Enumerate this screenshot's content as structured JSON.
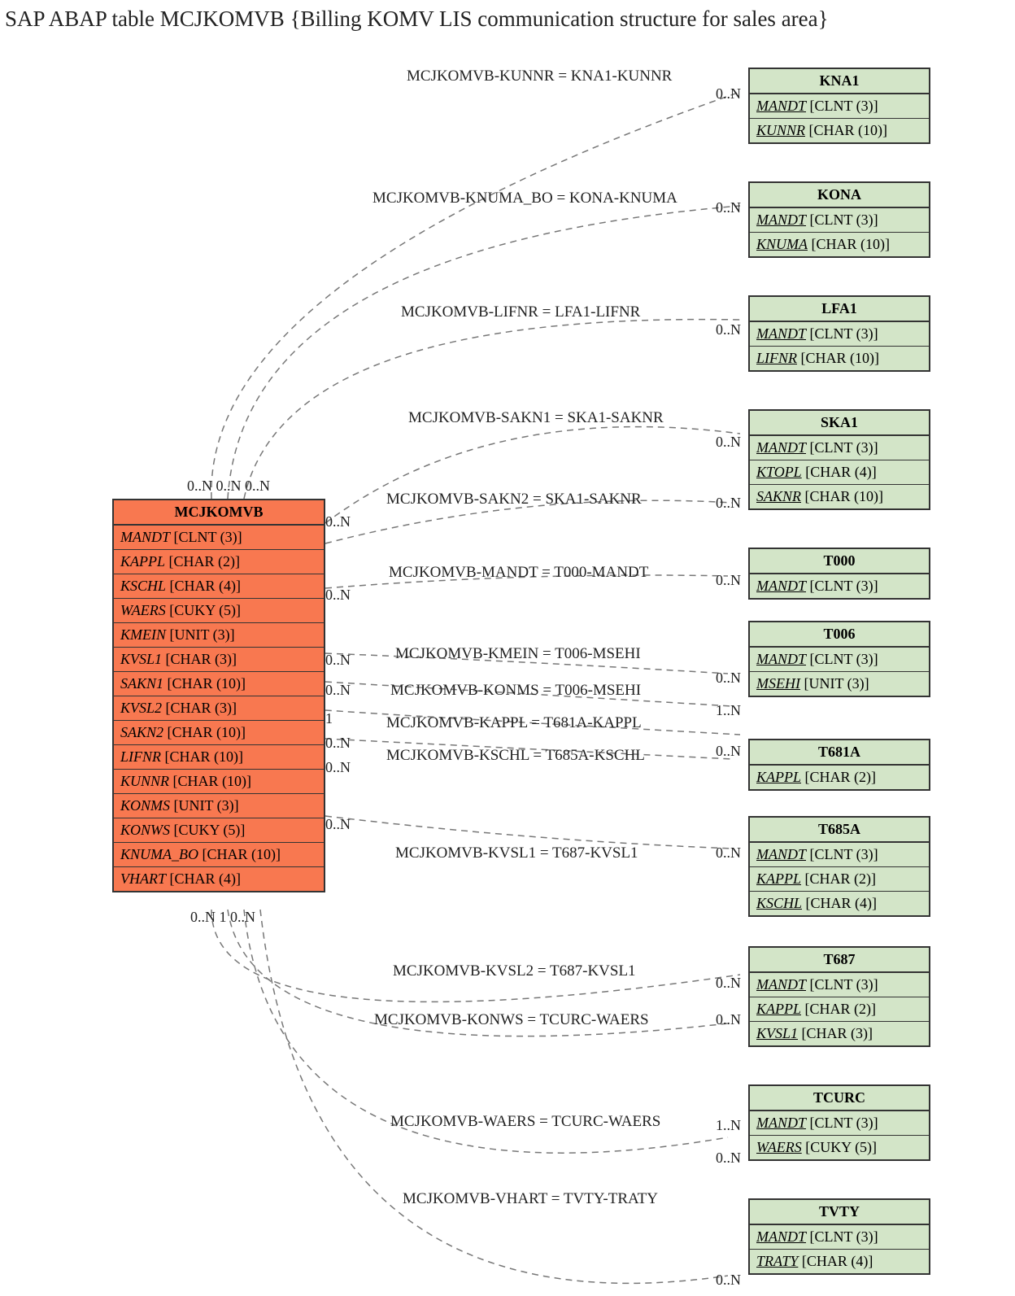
{
  "title": "SAP ABAP table MCJKOMVB {Billing KOMV LIS communication structure for sales area}",
  "main_table": {
    "name": "MCJKOMVB",
    "fields": [
      {
        "name": "MANDT",
        "type": "CLNT (3)"
      },
      {
        "name": "KAPPL",
        "type": "CHAR (2)"
      },
      {
        "name": "KSCHL",
        "type": "CHAR (4)"
      },
      {
        "name": "WAERS",
        "type": "CUKY (5)"
      },
      {
        "name": "KMEIN",
        "type": "UNIT (3)"
      },
      {
        "name": "KVSL1",
        "type": "CHAR (3)"
      },
      {
        "name": "SAKN1",
        "type": "CHAR (10)"
      },
      {
        "name": "KVSL2",
        "type": "CHAR (3)"
      },
      {
        "name": "SAKN2",
        "type": "CHAR (10)"
      },
      {
        "name": "LIFNR",
        "type": "CHAR (10)"
      },
      {
        "name": "KUNNR",
        "type": "CHAR (10)"
      },
      {
        "name": "KONMS",
        "type": "UNIT (3)"
      },
      {
        "name": "KONWS",
        "type": "CUKY (5)"
      },
      {
        "name": "KNUMA_BO",
        "type": "CHAR (10)"
      },
      {
        "name": "VHART",
        "type": "CHAR (4)"
      }
    ]
  },
  "ref_tables": [
    {
      "name": "KNA1",
      "fields": [
        {
          "name": "MANDT",
          "type": "CLNT (3)",
          "u": true
        },
        {
          "name": "KUNNR",
          "type": "CHAR (10)",
          "u": true
        }
      ]
    },
    {
      "name": "KONA",
      "fields": [
        {
          "name": "MANDT",
          "type": "CLNT (3)",
          "u": true
        },
        {
          "name": "KNUMA",
          "type": "CHAR (10)",
          "u": true
        }
      ]
    },
    {
      "name": "LFA1",
      "fields": [
        {
          "name": "MANDT",
          "type": "CLNT (3)",
          "u": true
        },
        {
          "name": "LIFNR",
          "type": "CHAR (10)",
          "u": true
        }
      ]
    },
    {
      "name": "SKA1",
      "fields": [
        {
          "name": "MANDT",
          "type": "CLNT (3)",
          "u": true
        },
        {
          "name": "KTOPL",
          "type": "CHAR (4)",
          "u": true
        },
        {
          "name": "SAKNR",
          "type": "CHAR (10)",
          "u": true
        }
      ]
    },
    {
      "name": "T000",
      "fields": [
        {
          "name": "MANDT",
          "type": "CLNT (3)",
          "u": true
        }
      ]
    },
    {
      "name": "T006",
      "fields": [
        {
          "name": "MANDT",
          "type": "CLNT (3)",
          "u": true
        },
        {
          "name": "MSEHI",
          "type": "UNIT (3)",
          "u": true
        }
      ]
    },
    {
      "name": "T681A",
      "fields": [
        {
          "name": "KAPPL",
          "type": "CHAR (2)",
          "u": true
        }
      ]
    },
    {
      "name": "T685A",
      "fields": [
        {
          "name": "MANDT",
          "type": "CLNT (3)",
          "u": true
        },
        {
          "name": "KAPPL",
          "type": "CHAR (2)",
          "u": true
        },
        {
          "name": "KSCHL",
          "type": "CHAR (4)",
          "u": true
        }
      ]
    },
    {
      "name": "T687",
      "fields": [
        {
          "name": "MANDT",
          "type": "CLNT (3)",
          "u": true
        },
        {
          "name": "KAPPL",
          "type": "CHAR (2)",
          "u": true
        },
        {
          "name": "KVSL1",
          "type": "CHAR (3)",
          "u": true
        }
      ]
    },
    {
      "name": "TCURC",
      "fields": [
        {
          "name": "MANDT",
          "type": "CLNT (3)",
          "u": true
        },
        {
          "name": "WAERS",
          "type": "CUKY (5)",
          "u": true
        }
      ]
    },
    {
      "name": "TVTY",
      "fields": [
        {
          "name": "MANDT",
          "type": "CLNT (3)",
          "u": true
        },
        {
          "name": "TRATY",
          "type": "CHAR (4)",
          "u": true
        }
      ]
    }
  ],
  "relations": [
    {
      "text": "MCJKOMVB-KUNNR = KNA1-KUNNR"
    },
    {
      "text": "MCJKOMVB-KNUMA_BO = KONA-KNUMA"
    },
    {
      "text": "MCJKOMVB-LIFNR = LFA1-LIFNR"
    },
    {
      "text": "MCJKOMVB-SAKN1 = SKA1-SAKNR"
    },
    {
      "text": "MCJKOMVB-SAKN2 = SKA1-SAKNR"
    },
    {
      "text": "MCJKOMVB-MANDT = T000-MANDT"
    },
    {
      "text": "MCJKOMVB-KMEIN = T006-MSEHI"
    },
    {
      "text": "MCJKOMVB-KONMS = T006-MSEHI"
    },
    {
      "text": "MCJKOMVB-KAPPL = T681A-KAPPL"
    },
    {
      "text": "MCJKOMVB-KSCHL = T685A-KSCHL"
    },
    {
      "text": "MCJKOMVB-KVSL1 = T687-KVSL1"
    },
    {
      "text": "MCJKOMVB-KVSL2 = T687-KVSL1"
    },
    {
      "text": "MCJKOMVB-KONWS = TCURC-WAERS"
    },
    {
      "text": "MCJKOMVB-WAERS = TCURC-WAERS"
    },
    {
      "text": "MCJKOMVB-VHART = TVTY-TRATY"
    }
  ],
  "card": {
    "zn": "0..N",
    "on": "1..N",
    "one": "1"
  },
  "main_top_cards": "0..N 0..N 0..N",
  "main_bottom_cards": "0..N 1 0..N"
}
